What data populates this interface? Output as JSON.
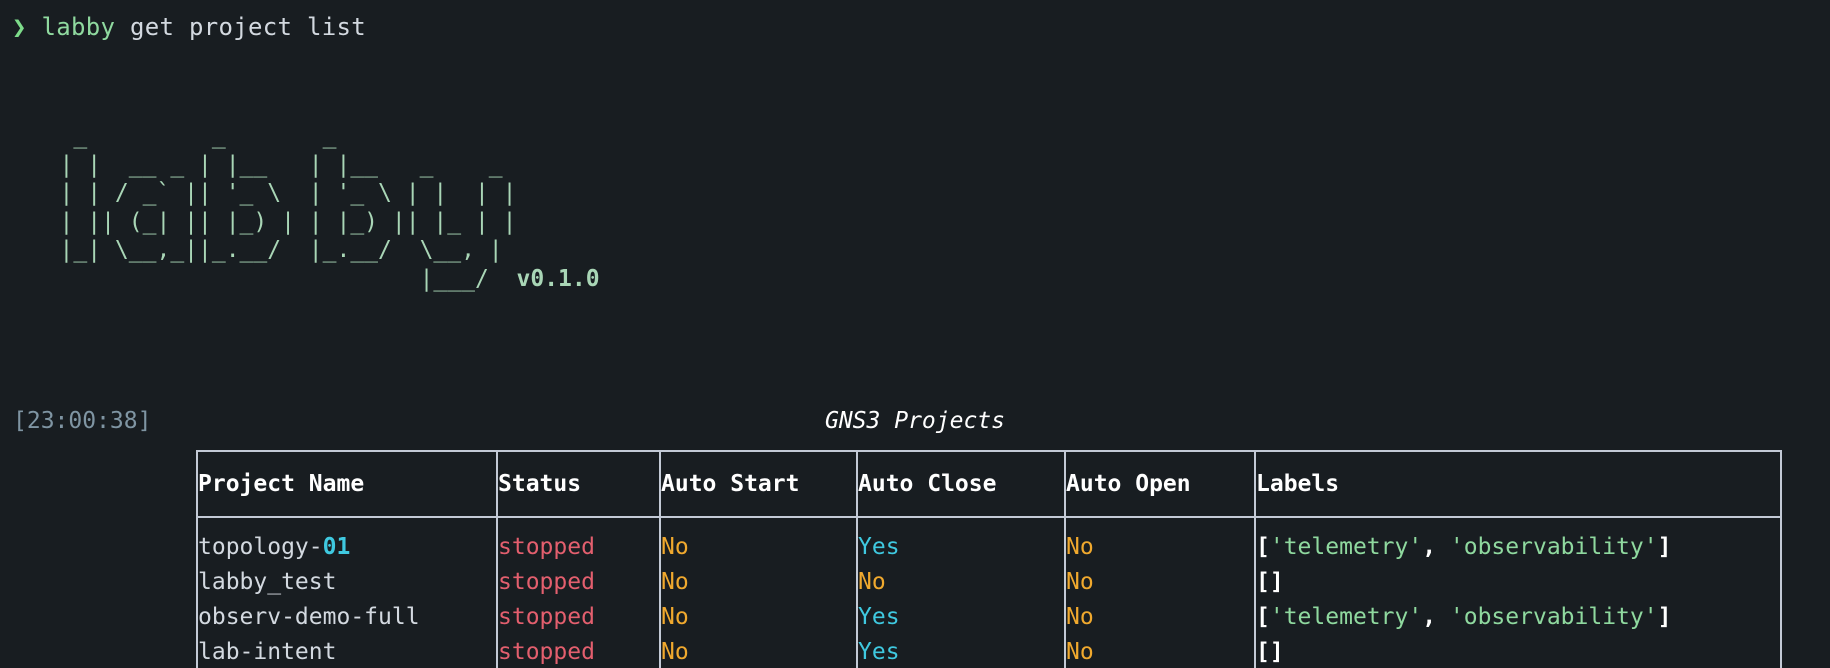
{
  "terminal": {
    "background_color": "#181d21",
    "foreground_color": "#d6dbe0"
  },
  "prompt": {
    "sigil": "❯",
    "command_app": "labby",
    "command_args": " get project list",
    "sigil_color": "#7ddc8a",
    "app_color": "#8fd99f"
  },
  "banner": {
    "ascii_art": "    _         _       _\n   | |  __ _ | |__   | |__   _    _\n   | | / _` || '_ \\  | '_ \\ | |  | |\n   | || (_| || |_) | | |_) || |_ | |\n   |_| \\__,_||_.__/  |_.__/  \\__, |\n                             |___/",
    "version": "v0.1.0",
    "color": "#a9d6b6"
  },
  "log": {
    "timestamp": "[23:00:38]",
    "timestamp_color": "#7f95a3",
    "title": "GNS3 Projects",
    "title_color": "#ffffff"
  },
  "table": {
    "border_color": "#c3cad6",
    "headers": [
      "Project Name",
      "Status",
      "Auto Start",
      "Auto Close",
      "Auto Open",
      "Labels"
    ],
    "rows": [
      {
        "project_name_text": "topology-",
        "project_name_num": "01",
        "status": "stopped",
        "auto_start": "No",
        "auto_close": "Yes",
        "auto_open": "No",
        "labels": "['telemetry', 'observability']"
      },
      {
        "project_name_text": "labby_test",
        "project_name_num": "",
        "status": "stopped",
        "auto_start": "No",
        "auto_close": "No",
        "auto_open": "No",
        "labels": "[]"
      },
      {
        "project_name_text": "observ-demo-full",
        "project_name_num": "",
        "status": "stopped",
        "auto_start": "No",
        "auto_close": "Yes",
        "auto_open": "No",
        "labels": "['telemetry', 'observability']"
      },
      {
        "project_name_text": "lab-intent",
        "project_name_num": "",
        "status": "stopped",
        "auto_start": "No",
        "auto_close": "Yes",
        "auto_open": "No",
        "labels": "[]"
      }
    ],
    "value_colors": {
      "stopped": "#e35f6e",
      "yes": "#3fc9e0",
      "no": "#f0a92e",
      "number": "#3fc9e0",
      "label_string": "#8fd99f",
      "label_bracket": "#ffffff"
    }
  }
}
